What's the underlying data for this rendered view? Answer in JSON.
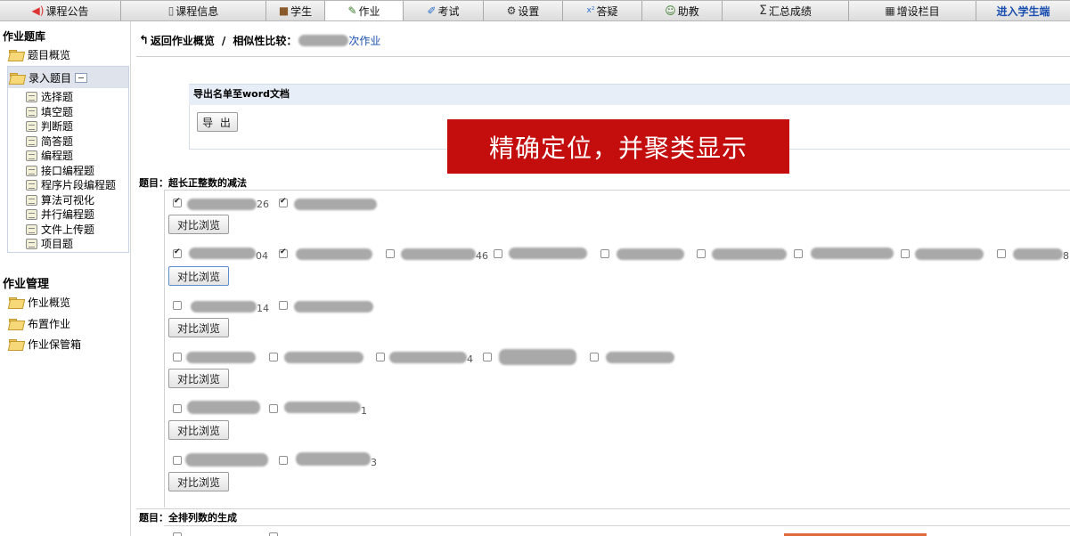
{
  "topnav": {
    "tabs": [
      {
        "label": "课程公告",
        "icon": "speaker-icon"
      },
      {
        "label": "课程信息",
        "icon": "book-icon"
      },
      {
        "label": "学生",
        "icon": "students-icon"
      },
      {
        "label": "作业",
        "icon": "homework-icon",
        "active": true
      },
      {
        "label": "考试",
        "icon": "exam-icon"
      },
      {
        "label": "设置",
        "icon": "gear-icon"
      },
      {
        "label": "答疑",
        "icon": "qa-icon"
      },
      {
        "label": "助教",
        "icon": "assistant-icon"
      },
      {
        "label": "汇总成绩",
        "icon": "sigma-icon"
      },
      {
        "label": "增设栏目",
        "icon": "grid-icon"
      }
    ],
    "enter_student": "进入学生端"
  },
  "sidebar": {
    "bank_heading": "作业题库",
    "overview": "题目概览",
    "entry": "录入题目",
    "entry_items": [
      "选择题",
      "填空题",
      "判断题",
      "简答题",
      "编程题",
      "接口编程题",
      "程序片段编程题",
      "算法可视化",
      "并行编程题",
      "文件上传题",
      "项目题"
    ],
    "manage_heading": "作业管理",
    "manage_items": [
      "作业概览",
      "布置作业",
      "作业保管箱"
    ]
  },
  "breadcrumb": {
    "back": "返回作业概览",
    "separator": "/",
    "current": "相似性比较：",
    "link_tail": "次作业"
  },
  "export": {
    "heading": "导出名单至word文档",
    "button": "导 出"
  },
  "banner": "精确定位，并聚类显示",
  "questions": [
    {
      "title": "题目：超长正整数的减法",
      "compare_label": "对比浏览",
      "groups": [
        {
          "fragments": [
            "26",
            "",
            "",
            ""
          ]
        },
        {
          "fragments": [
            "04",
            "",
            "46",
            "",
            "",
            "",
            "",
            "",
            "",
            "8"
          ]
        },
        {
          "fragments": [
            "14",
            ""
          ]
        },
        {
          "fragments": [
            "4",
            "",
            ""
          ]
        },
        {
          "fragments": [
            "",
            "1"
          ]
        },
        {
          "fragments": [
            "",
            "3"
          ]
        }
      ]
    },
    {
      "title": "题目：全排列数的生成"
    }
  ],
  "colors": {
    "banner_bg": "#c40d0d",
    "link": "#1a4fb0",
    "export_head_bg": "#e8eef8"
  }
}
